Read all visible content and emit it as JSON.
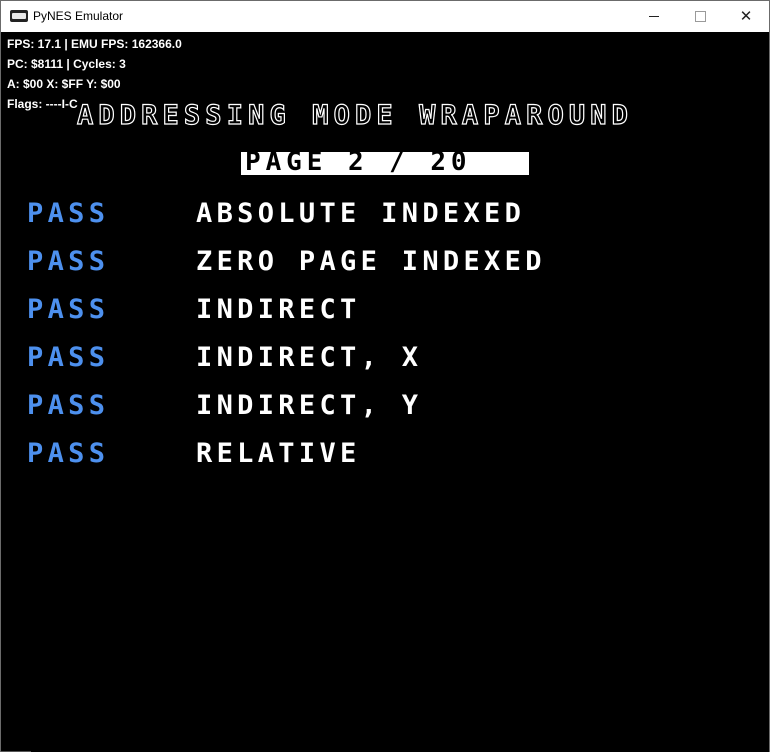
{
  "window": {
    "title": "PyNES Emulator",
    "app_icon": "pynes-app-icon",
    "controls": [
      "minimize-icon",
      "maximize-icon",
      "close-icon"
    ],
    "close_glyph": "✕"
  },
  "hud": {
    "fps_line": "FPS: 17.1 | EMU FPS: 162366.0",
    "pc_line": "PC: $8111 | Cycles: 3",
    "regs_line": "A: $00 X: $FF Y: $00",
    "flags_line": "Flags: ----I-C"
  },
  "test_screen": {
    "title": "ADDRESSING MODE WRAPAROUND",
    "page_label": "PAGE  2 / 20",
    "results": [
      {
        "status": "PASS",
        "name": "ABSOLUTE INDEXED"
      },
      {
        "status": "PASS",
        "name": "ZERO PAGE INDEXED"
      },
      {
        "status": "PASS",
        "name": "INDIRECT"
      },
      {
        "status": "PASS",
        "name": "INDIRECT, X"
      },
      {
        "status": "PASS",
        "name": "INDIRECT, Y"
      },
      {
        "status": "PASS",
        "name": "RELATIVE"
      }
    ]
  },
  "colors": {
    "pass": "#4d90ee",
    "text": "#ffffff",
    "background": "#000000"
  }
}
